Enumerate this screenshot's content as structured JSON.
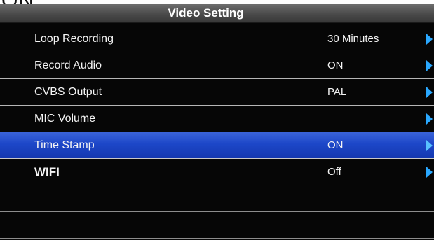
{
  "top_fragment": "ON",
  "header": {
    "title": "Video Setting"
  },
  "menu": {
    "items": [
      {
        "label": "Loop Recording",
        "value": "30 Minutes",
        "selected": false
      },
      {
        "label": "Record Audio",
        "value": "ON",
        "selected": false
      },
      {
        "label": "CVBS Output",
        "value": "PAL",
        "selected": false
      },
      {
        "label": "MIC Volume",
        "value": "",
        "selected": false
      },
      {
        "label": "Time Stamp",
        "value": "ON",
        "selected": true
      },
      {
        "label": "WIFI",
        "value": "Off",
        "selected": false
      }
    ]
  },
  "icons": {
    "row_arrow": "chevron-right-icon"
  },
  "colors": {
    "highlight": "#1d47c8",
    "arrow": "#2aa8ff",
    "title_bar": "#4a4a4a",
    "background": "#060606"
  }
}
